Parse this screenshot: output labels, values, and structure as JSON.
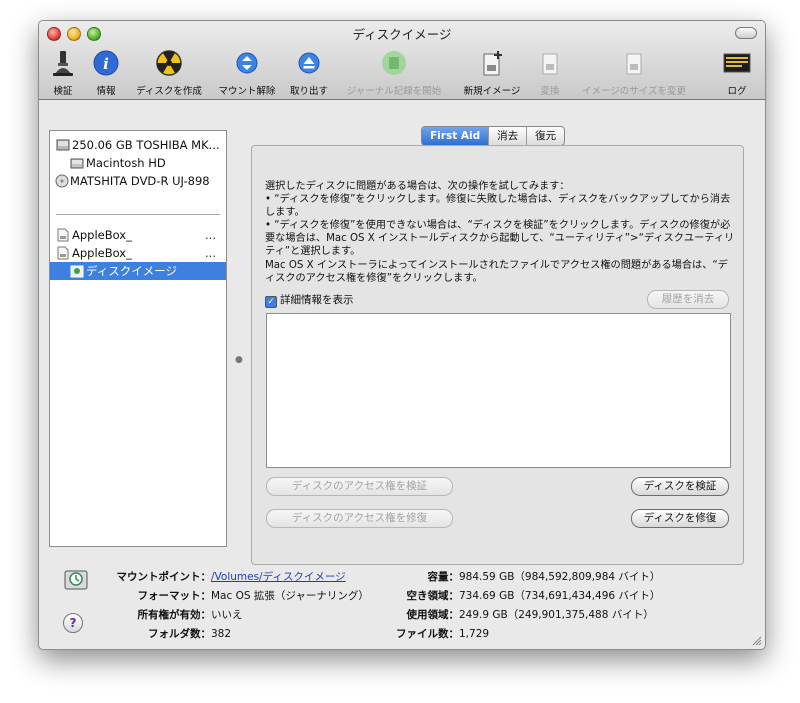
{
  "window": {
    "title": "ディスクイメージ"
  },
  "toolbar": {
    "items": [
      {
        "label": "検証",
        "icon": "microscope-icon",
        "enabled": true
      },
      {
        "label": "情報",
        "icon": "info-icon",
        "enabled": true
      },
      {
        "label": "ディスクを作成",
        "icon": "burn-icon",
        "enabled": true
      },
      {
        "label": "マウント解除",
        "icon": "unmount-icon",
        "enabled": true
      },
      {
        "label": "取り出す",
        "icon": "eject-icon",
        "enabled": true
      },
      {
        "label": "ジャーナル記録を開始",
        "icon": "journal-icon",
        "enabled": false
      },
      {
        "label": "新規イメージ",
        "icon": "new-image-icon",
        "enabled": true
      },
      {
        "label": "変換",
        "icon": "convert-icon",
        "enabled": false
      },
      {
        "label": "イメージのサイズを変更",
        "icon": "resize-image-icon",
        "enabled": false
      },
      {
        "label": "ログ",
        "icon": "log-icon",
        "enabled": true
      }
    ]
  },
  "sidebar": {
    "items": [
      {
        "label": "250.06 GB TOSHIBA MK...",
        "icon": "hard-disk-icon"
      },
      {
        "label": "Macintosh HD",
        "icon": "volume-icon"
      },
      {
        "label": "MATSHITA DVD-R UJ-898",
        "icon": "optical-drive-icon"
      },
      {
        "label": "AppleBox_",
        "icon": "disk-image-file-icon",
        "suffix": "..."
      },
      {
        "label": "AppleBox_",
        "icon": "disk-image-file-icon",
        "suffix": "..."
      },
      {
        "label": "ディスクイメージ",
        "icon": "mounted-image-icon",
        "selected": true
      }
    ]
  },
  "tabs": [
    {
      "label": "First Aid",
      "active": true
    },
    {
      "label": "消去",
      "active": false
    },
    {
      "label": "復元",
      "active": false
    }
  ],
  "first_aid": {
    "intro": "選択したディスクに問題がある場合は、次の操作を試してみます：",
    "bullet1": "• “ディスクを修復”をクリックします。修復に失敗した場合は、ディスクをバックアップしてから消去します。",
    "bullet2": "• “ディスクを修復”を使用できない場合は、“ディスクを検証”をクリックします。ディスクの修復が必要な場合は、Mac OS X インストールディスクから起動して、“ユーティリティ”>“ディスクユーティリティ”と選択します。",
    "para2": "Mac OS X インストーラによってインストールされたファイルでアクセス権の問題がある場合は、“ディスクのアクセス権を修復”をクリックします。",
    "show_details_label": "詳細情報を表示",
    "show_details_checked": true,
    "clear_history_label": "履歴を消去",
    "verify_permissions_label": "ディスクのアクセス権を検証",
    "repair_permissions_label": "ディスクのアクセス権を修復",
    "verify_disk_label": "ディスクを検証",
    "repair_disk_label": "ディスクを修復"
  },
  "info": {
    "mount_point_key": "マウントポイント：",
    "mount_point_value": "/Volumes/ディスクイメージ",
    "format_key": "フォーマット：",
    "format_value": "Mac OS 拡張（ジャーナリング）",
    "owners_key": "所有権が有効：",
    "owners_value": "いいえ",
    "folders_key": "フォルダ数：",
    "folders_value": "382",
    "capacity_key": "容量：",
    "capacity_value": "984.59 GB（984,592,809,984 バイト）",
    "available_key": "空き領域：",
    "available_value": "734.69 GB（734,691,434,496 バイト）",
    "used_key": "使用領域：",
    "used_value": "249.9 GB（249,901,375,488 バイト）",
    "files_key": "ファイル数：",
    "files_value": "1,729"
  },
  "help_glyph": "?"
}
